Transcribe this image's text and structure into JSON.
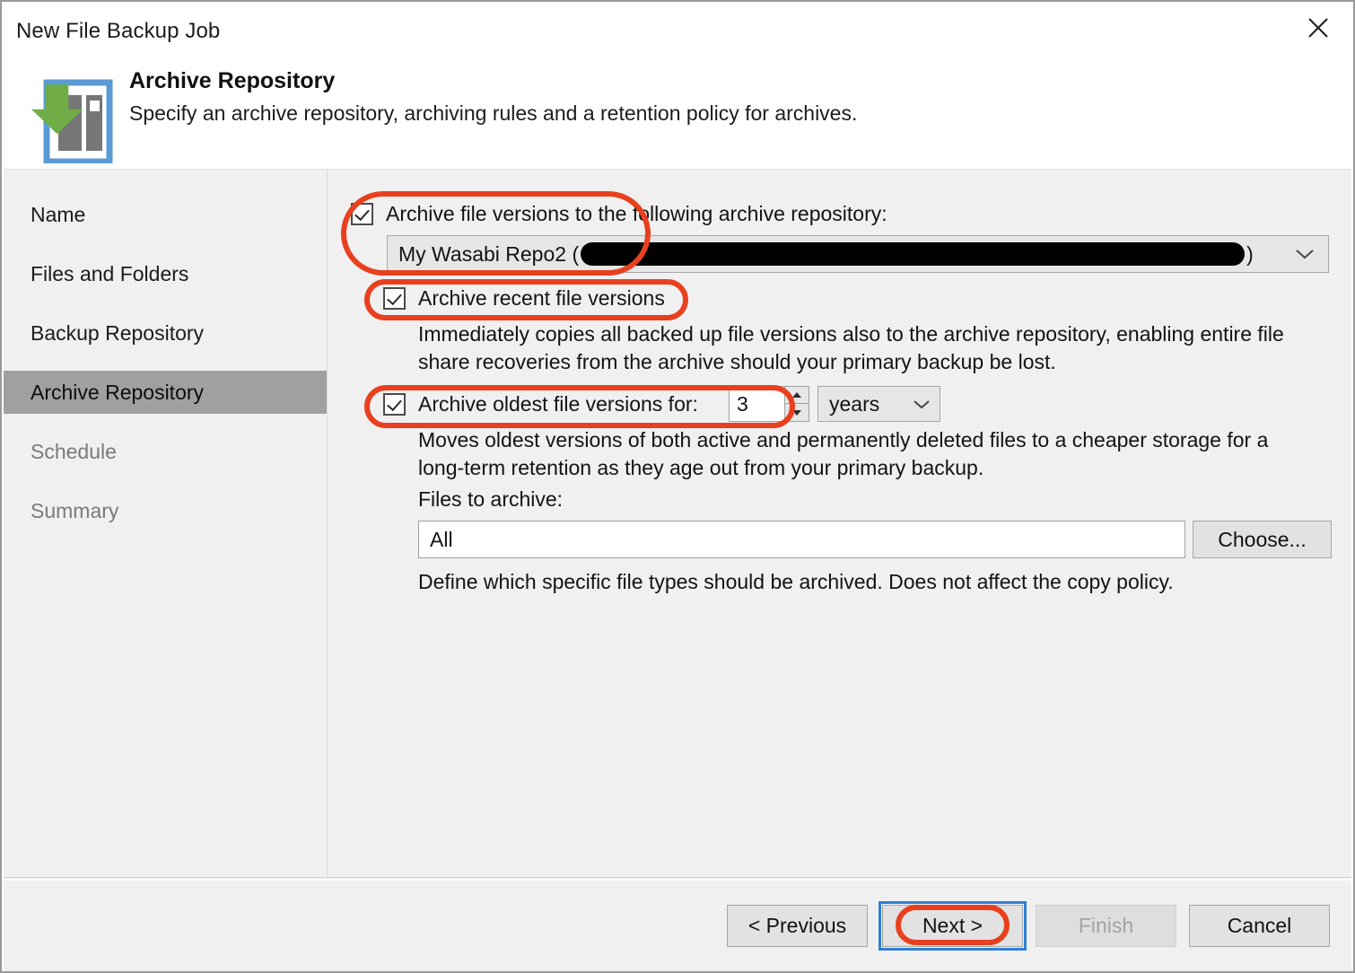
{
  "window": {
    "title": "New File Backup Job",
    "close_icon": "close-icon"
  },
  "header": {
    "title": "Archive Repository",
    "subtitle": "Specify an archive repository, archiving rules and a retention policy for archives.",
    "icon": "archive-repository-icon"
  },
  "sidebar": {
    "items": [
      {
        "label": "Name",
        "selected": false,
        "disabled": false
      },
      {
        "label": "Files and Folders",
        "selected": false,
        "disabled": false
      },
      {
        "label": "Backup Repository",
        "selected": false,
        "disabled": false
      },
      {
        "label": "Archive Repository",
        "selected": true,
        "disabled": false
      },
      {
        "label": "Schedule",
        "selected": false,
        "disabled": true
      },
      {
        "label": "Summary",
        "selected": false,
        "disabled": true
      }
    ]
  },
  "main": {
    "archive_enable": {
      "label": "Archive file versions to the following archive repository:",
      "checked": true
    },
    "repository_combo": {
      "prefix": "My Wasabi Repo2 (",
      "redacted": true,
      "suffix": ")",
      "chevron": "chevron-down-icon"
    },
    "archive_recent": {
      "label": "Archive recent file versions",
      "checked": true,
      "description": "Immediately copies all backed up file versions also to the archive repository, enabling entire file share recoveries from the archive should your primary backup be lost."
    },
    "archive_oldest": {
      "label": "Archive oldest file versions for:",
      "checked": true,
      "value": "3",
      "unit": "years",
      "unit_chevron": "chevron-down-icon",
      "spinner_up": "spinner-up-icon",
      "spinner_down": "spinner-down-icon",
      "description": "Moves oldest versions of both active and permanently deleted files to a cheaper storage for a long-term retention as they age out from your primary backup."
    },
    "files_to_archive": {
      "label": "Files to archive:",
      "value": "All",
      "choose_label": "Choose...",
      "description": "Define which specific file types should be archived. Does not affect the copy policy."
    }
  },
  "footer": {
    "previous_label": "< Previous",
    "next_label": "Next >",
    "finish_label": "Finish",
    "cancel_label": "Cancel"
  },
  "annotations": {
    "accent_color": "#e8401f",
    "focus_color": "#2f7fd4"
  }
}
